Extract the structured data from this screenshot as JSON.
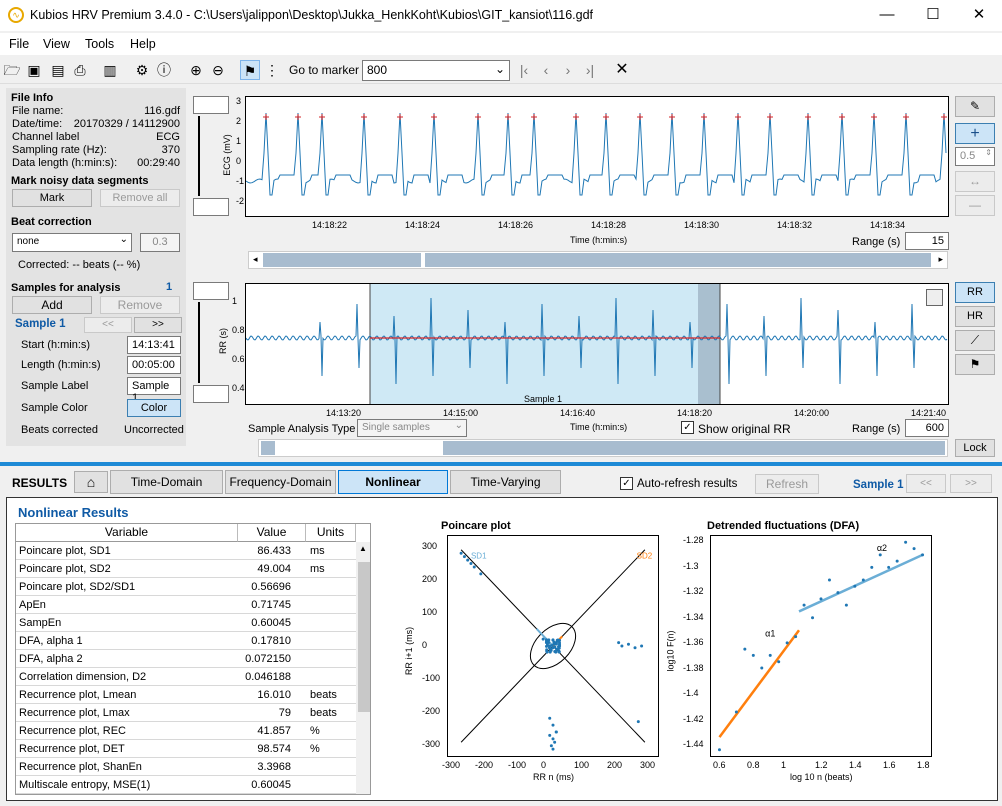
{
  "window": {
    "title": "Kubios HRV Premium 3.4.0 - C:\\Users\\jalippon\\Desktop\\Jukka_HenkKoht\\Kubios\\GIT_kansiot\\116.gdf"
  },
  "menu": [
    "File",
    "View",
    "Tools",
    "Help"
  ],
  "toolbar": {
    "goto_label": "Go to marker",
    "goto_value": "800"
  },
  "fileinfo": {
    "title": "File Info",
    "rows": [
      [
        "File name:",
        "116.gdf"
      ],
      [
        "Date/time:",
        "20170329 / 14112900"
      ],
      [
        "Channel label",
        "ECG"
      ],
      [
        "Sampling rate (Hz):",
        "370"
      ],
      [
        "Data length (h:min:s):",
        "00:29:40"
      ]
    ]
  },
  "noisy": {
    "title": "Mark noisy data segments",
    "mark": "Mark",
    "remove_all": "Remove all"
  },
  "beat": {
    "title": "Beat correction",
    "method": "none",
    "value": "0.3",
    "corrected": "Corrected: -- beats (-- %)"
  },
  "samples": {
    "title": "Samples for analysis",
    "count": "1",
    "add": "Add",
    "remove": "Remove",
    "sample": "Sample 1",
    "prev": "<<",
    "next": ">>",
    "start_label": "Start (h:min:s)",
    "start": "14:13:41",
    "length_label": "Length (h:min:s)",
    "length": "00:05:00",
    "label_label": "Sample Label",
    "label": "Sample 1",
    "color_label": "Sample Color",
    "color_btn": "Color",
    "beats_label": "Beats corrected",
    "beats": "Uncorrected"
  },
  "ecg": {
    "ylabel": "ECG (mV)",
    "yticks": [
      "3",
      "2",
      "1",
      "0",
      "-1",
      "-2"
    ],
    "xticks": [
      "14:18:22",
      "14:18:24",
      "14:18:26",
      "14:18:28",
      "14:18:30",
      "14:18:32",
      "14:18:34"
    ],
    "xlabel": "Time (h:min:s)",
    "range_label": "Range (s)",
    "range": "15"
  },
  "rr": {
    "ylabel": "RR (s)",
    "yticks": [
      "1",
      "0.8",
      "0.6",
      "0.4"
    ],
    "xticks": [
      "14:13:20",
      "14:15:00",
      "14:16:40",
      "14:18:20",
      "14:20:00",
      "14:21:40"
    ],
    "xlabel": "Time (h:min:s)",
    "sample_label": "Sample 1",
    "analysis_type_label": "Sample Analysis Type",
    "analysis_type": "Single samples",
    "show_orig": "Show original RR",
    "range_label": "Range (s)",
    "range": "600"
  },
  "right": {
    "zoom": "0.5",
    "rr": "RR",
    "hr": "HR",
    "lock": "Lock"
  },
  "results": {
    "label": "RESULTS",
    "tabs": [
      "Time-Domain",
      "Frequency-Domain",
      "Nonlinear",
      "Time-Varying"
    ],
    "auto": "Auto-refresh results",
    "refresh": "Refresh",
    "sample": "Sample 1",
    "prev": "<<",
    "next": ">>"
  },
  "nonlinear": {
    "title": "Nonlinear Results",
    "headers": [
      "Variable",
      "Value",
      "Units"
    ],
    "rows": [
      [
        "Poincare plot, SD1",
        "86.433",
        "ms"
      ],
      [
        "Poincare plot, SD2",
        "49.004",
        "ms"
      ],
      [
        "Poincare plot, SD2/SD1",
        "0.56696",
        ""
      ],
      [
        "ApEn",
        "0.71745",
        ""
      ],
      [
        "SampEn",
        "0.60045",
        ""
      ],
      [
        "DFA, alpha 1",
        "0.17810",
        ""
      ],
      [
        "DFA, alpha 2",
        "0.072150",
        ""
      ],
      [
        "Correlation dimension, D2",
        "0.046188",
        ""
      ],
      [
        "Recurrence plot, Lmean",
        "16.010",
        "beats"
      ],
      [
        "Recurrence plot, Lmax",
        "79",
        "beats"
      ],
      [
        "Recurrence plot, REC",
        "41.857",
        "%"
      ],
      [
        "Recurrence plot, DET",
        "98.574",
        "%"
      ],
      [
        "Recurrence plot, ShanEn",
        "3.3968",
        ""
      ],
      [
        "Multiscale entropy, MSE(1)",
        "0.60045",
        ""
      ]
    ]
  },
  "poincare": {
    "title": "Poincare plot",
    "ylabel": "RR i+1 (ms)",
    "xlabel": "RR n (ms)",
    "ticks": [
      "300",
      "200",
      "100",
      "0",
      "-100",
      "-200",
      "-300"
    ],
    "xticks": [
      "-300",
      "-200",
      "-100",
      "0",
      "100",
      "200",
      "300"
    ],
    "sd1": "SD1",
    "sd2": "SD2"
  },
  "dfa": {
    "title": "Detrended fluctuations (DFA)",
    "ylabel": "log10 F(n)",
    "xlabel": "log 10 n (beats)",
    "yticks": [
      "-1.28",
      "-1.3",
      "-1.32",
      "-1.34",
      "-1.36",
      "-1.38",
      "-1.4",
      "-1.42",
      "-1.44"
    ],
    "xticks": [
      "0.6",
      "0.8",
      "1",
      "1.2",
      "1.4",
      "1.6",
      "1.8"
    ],
    "a1": "α1",
    "a2": "α2"
  },
  "chart_data": [
    {
      "type": "scatter",
      "title": "Poincare plot",
      "xlabel": "RR n (ms)",
      "ylabel": "RR i+1 (ms)",
      "xlim": [
        -320,
        320
      ],
      "ylim": [
        -320,
        320
      ],
      "x": [
        -280,
        -270,
        -260,
        -250,
        -240,
        -220,
        -30,
        -20,
        -10,
        0,
        5,
        10,
        15,
        20,
        -10,
        0,
        10,
        200,
        210,
        230,
        250,
        270,
        -10,
        0,
        5,
        10,
        0,
        -5,
        260
      ],
      "y": [
        270,
        260,
        250,
        240,
        230,
        210,
        20,
        10,
        0,
        -5,
        5,
        10,
        -10,
        0,
        -210,
        -230,
        -250,
        10,
        0,
        5,
        -5,
        0,
        -260,
        -270,
        -280,
        -250,
        -300,
        -290,
        -220
      ]
    },
    {
      "type": "scatter",
      "title": "Detrended fluctuations (DFA)",
      "xlabel": "log 10 n (beats)",
      "ylabel": "log10 F(n)",
      "xlim": [
        0.55,
        1.85
      ],
      "ylim": [
        -1.45,
        -1.275
      ],
      "x": [
        0.6,
        0.7,
        0.75,
        0.8,
        0.85,
        0.9,
        0.95,
        1.0,
        1.05,
        1.1,
        1.15,
        1.2,
        1.25,
        1.3,
        1.35,
        1.4,
        1.45,
        1.5,
        1.55,
        1.6,
        1.65,
        1.7,
        1.75,
        1.8
      ],
      "y": [
        -1.445,
        -1.415,
        -1.365,
        -1.37,
        -1.38,
        -1.37,
        -1.375,
        -1.36,
        -1.355,
        -1.33,
        -1.34,
        -1.325,
        -1.31,
        -1.32,
        -1.33,
        -1.315,
        -1.31,
        -1.3,
        -1.29,
        -1.3,
        -1.295,
        -1.28,
        -1.285,
        -1.29
      ]
    }
  ]
}
